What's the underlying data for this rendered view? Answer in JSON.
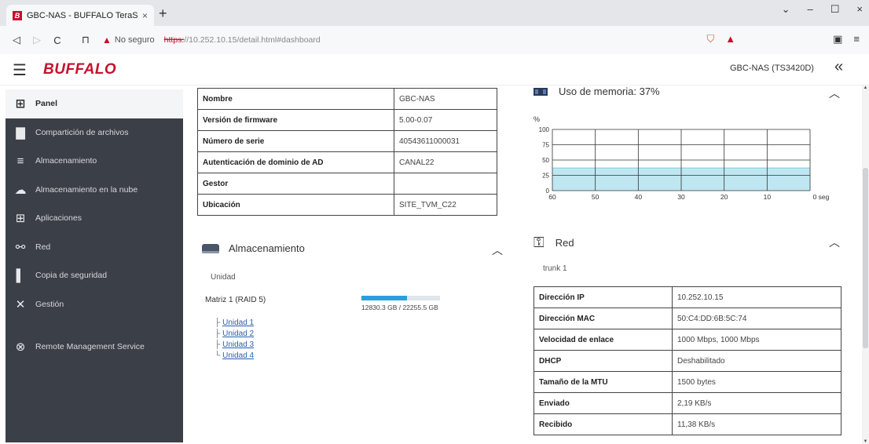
{
  "browser": {
    "tab_title": "GBC-NAS - BUFFALO TeraStation",
    "tab_favicon": "B",
    "tab_close": "×",
    "new_tab": "+",
    "security_label": "No seguro",
    "url_scheme": "https:",
    "url_rest": "//10.252.10.15/detail.html#dashboard",
    "controls": {
      "chevron": "⌄",
      "minimize": "–",
      "maximize": "☐",
      "close": "×"
    }
  },
  "header": {
    "logo": "BUFFALO",
    "device": "GBC-NAS (TS3420D)",
    "collapse_glyph": "«"
  },
  "sidebar": {
    "items": [
      {
        "label": "Panel",
        "icon": "dashboard-icon",
        "glyph": "⊞",
        "active": true
      },
      {
        "label": "Compartición de archivos",
        "icon": "folder-icon",
        "glyph": "▇"
      },
      {
        "label": "Almacenamiento",
        "icon": "storage-icon",
        "glyph": "≡"
      },
      {
        "label": "Almacenamiento en la nube",
        "icon": "cloud-icon",
        "glyph": "☁"
      },
      {
        "label": "Aplicaciones",
        "icon": "apps-icon",
        "glyph": "⊞"
      },
      {
        "label": "Red",
        "icon": "network-icon",
        "glyph": "⚯"
      },
      {
        "label": "Copia de seguridad",
        "icon": "backup-icon",
        "glyph": "▌"
      },
      {
        "label": "Gestión",
        "icon": "tools-icon",
        "glyph": "✕"
      }
    ],
    "remote": {
      "label": "Remote Management Service",
      "icon": "remote-icon",
      "glyph": "⊗"
    }
  },
  "system_info": {
    "rows": [
      {
        "key": "Nombre",
        "value": "GBC-NAS"
      },
      {
        "key": "Versión de firmware",
        "value": "5.00-0.07"
      },
      {
        "key": "Número de serie",
        "value": "40543611000031"
      },
      {
        "key": "Autenticación de dominio de AD",
        "value": "CANAL22"
      },
      {
        "key": "Gestor",
        "value": ""
      },
      {
        "key": "Ubicación",
        "value": "SITE_TVM_C22"
      }
    ]
  },
  "storage": {
    "title": "Almacenamiento",
    "unit_header": "Unidad",
    "array_name": "Matriz 1 (RAID 5)",
    "used_gb": 12830.3,
    "total_gb": 22255.5,
    "capacity_text": "12830.3 GB / 22255.5 GB",
    "units": [
      "Unidad 1",
      "Unidad 2",
      "Unidad 3",
      "Unidad 4"
    ]
  },
  "memory": {
    "title": "Uso de memoria: 37%",
    "chart_data": {
      "type": "area",
      "title": "Uso de memoria: 37%",
      "ylabel": "%",
      "xlabel": "seg",
      "ylim": [
        0,
        100
      ],
      "xlim": [
        60,
        0
      ],
      "yticks": [
        0,
        25,
        50,
        75,
        100
      ],
      "xticks": [
        60,
        50,
        40,
        30,
        20,
        10,
        0
      ],
      "series": [
        {
          "x": [
            60,
            50,
            40,
            30,
            20,
            10,
            0
          ],
          "values": [
            37,
            37,
            37,
            37,
            37,
            37,
            37
          ]
        }
      ],
      "grid": true
    }
  },
  "network": {
    "title": "Red",
    "interface": "trunk 1",
    "rows": [
      {
        "key": "Dirección IP",
        "value": "10.252.10.15"
      },
      {
        "key": "Dirección MAC",
        "value": "50:C4:DD:6B:5C:74"
      },
      {
        "key": "Velocidad de enlace",
        "value": "1000 Mbps, 1000 Mbps"
      },
      {
        "key": "DHCP",
        "value": "Deshabilitado"
      },
      {
        "key": "Tamaño de la MTU",
        "value": "1500 bytes"
      },
      {
        "key": "Enviado",
        "value": "2,19 KB/s"
      },
      {
        "key": "Recibido",
        "value": "11,38 KB/s"
      }
    ]
  },
  "colors": {
    "accent": "#c8102e",
    "sidebar_bg": "#3b3f48",
    "bar": "#2b9fd9",
    "chart_fill": "#bfe7f2",
    "chart_line": "#7fcde0"
  }
}
